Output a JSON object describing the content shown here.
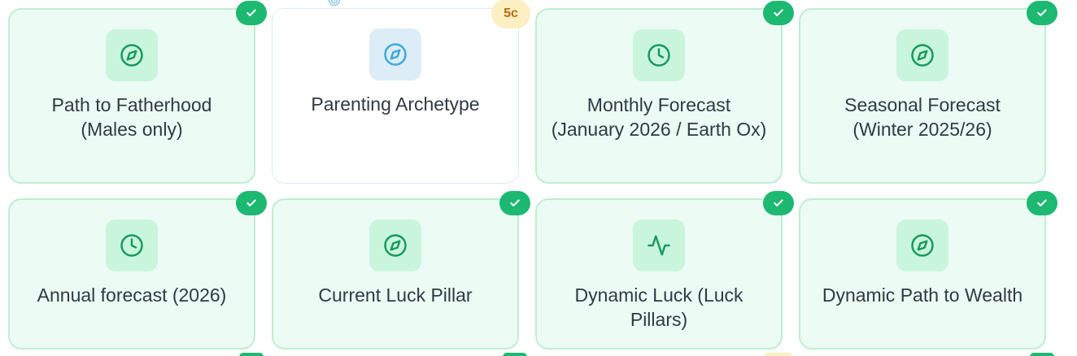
{
  "colors": {
    "card_bg": "#ecfbf3",
    "card_border": "#bfeed3",
    "icon_bg": "#c9f5dd",
    "icon_stroke": "#179a5e",
    "check_badge": "#1db872",
    "locked_icon_bg": "#dcedf7",
    "locked_icon_stroke": "#3fa9d9",
    "cost_badge_bg": "#fcefc2",
    "cost_badge_text": "#b86a10",
    "text": "#2f3a44"
  },
  "cards": [
    {
      "label": "Path to Fatherhood (Males only)",
      "icon": "compass-icon",
      "status": "completed"
    },
    {
      "label": "Parenting Archetype",
      "icon": "compass-icon",
      "status": "locked",
      "cost": "5c"
    },
    {
      "label": "Monthly Forecast (January 2026 / Earth Ox)",
      "icon": "clock-icon",
      "status": "completed"
    },
    {
      "label": "Seasonal Forecast (Winter 2025/26)",
      "icon": "compass-icon",
      "status": "completed"
    },
    {
      "label": "Annual forecast (2026)",
      "icon": "clock-icon",
      "status": "completed"
    },
    {
      "label": "Current Luck Pillar",
      "icon": "compass-icon",
      "status": "completed"
    },
    {
      "label": "Dynamic Luck (Luck Pillars)",
      "icon": "activity-icon",
      "status": "completed"
    },
    {
      "label": "Dynamic Path to Wealth",
      "icon": "compass-icon",
      "status": "completed"
    }
  ]
}
